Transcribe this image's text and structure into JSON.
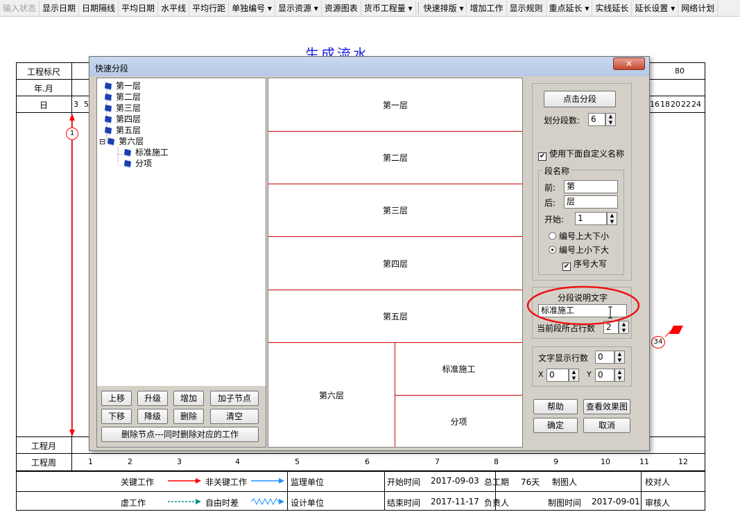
{
  "toolbar": {
    "items": [
      "输入状态",
      "显示日期",
      "日期隔线",
      "平均日期",
      "水平线",
      "平均行距",
      "单独编号 ▾",
      "显示资源 ▾",
      "资源图表",
      "货币工程量 ▾",
      "快速排版 ▾",
      "增加工作",
      "显示规则",
      "重点延长 ▾",
      "实线延长",
      "延长设置 ▾",
      "网络计划"
    ]
  },
  "background": {
    "title": "生成流水",
    "row_labels": {
      "ruler": "工程标尺",
      "year_month": "年.月",
      "day": "日",
      "project_month": "工程月",
      "project_week": "工程周"
    },
    "ruler_value": "80",
    "day_numbers_left": [
      "3",
      "5"
    ],
    "day_numbers_right": [
      "16",
      "18",
      "20",
      "22",
      "24"
    ],
    "node_1": "1",
    "node_34": "34",
    "week_numbers": [
      "1",
      "2",
      "3",
      "4",
      "5",
      "6",
      "7",
      "8",
      "9",
      "10",
      "11",
      "12"
    ],
    "colors": {
      "critical": "#ff0000",
      "noncritical": "#1e90ff",
      "virtual": "#009090",
      "title": "#2020e0"
    }
  },
  "footer": {
    "legend_critical": "关键工作",
    "legend_noncritical": "非关键工作",
    "legend_virtual": "虚工作",
    "legend_float": "自由时差",
    "supervisor_label": "监理单位",
    "design_label": "设计单位",
    "start_label": "开始时间",
    "start_value": "2017-09-03",
    "end_label": "结束时间",
    "end_value": "2017-11-17",
    "duration_label": "总工期",
    "duration_value": "76天",
    "owner_label": "负责人",
    "drafter_label": "制图人",
    "draw_time_label": "制图时间",
    "draw_time_value": "2017-09-01",
    "checker_label": "校对人",
    "reviewer_label": "审核人"
  },
  "dialog": {
    "title": "快速分段",
    "close": "✕",
    "tree": [
      {
        "label": "第一层",
        "level": 0
      },
      {
        "label": "第二层",
        "level": 0
      },
      {
        "label": "第三层",
        "level": 0
      },
      {
        "label": "第四层",
        "level": 0
      },
      {
        "label": "第五层",
        "level": 0
      },
      {
        "label": "第六层",
        "level": 0,
        "expander": "⊟"
      },
      {
        "label": "标准施工",
        "level": 1
      },
      {
        "label": "分项",
        "level": 1
      }
    ],
    "buttons": {
      "move_up": "上移",
      "promote": "升级",
      "add": "增加",
      "add_child": "加子节点",
      "move_down": "下移",
      "demote": "降级",
      "delete": "删除",
      "clear": "清空",
      "delete_node": "删除节点---同时删除对应的工作"
    },
    "segments": [
      "第一层",
      "第二层",
      "第三层",
      "第四层",
      "第五层",
      "第六层",
      "标准施工",
      "分项"
    ],
    "right": {
      "split_button": "点击分段",
      "count_label": "划分段数:",
      "count_value": "6",
      "use_custom_label": "使用下面自定义名称",
      "use_custom_checked": true,
      "seg_name_group": "段名称",
      "prefix_label": "前:",
      "prefix_value": "第",
      "suffix_label": "后:",
      "suffix_value": "层",
      "start_label": "开始:",
      "start_value": "1",
      "radio_1": "编号上大下小",
      "radio_2": "编号上小下大",
      "radio_selected": 2,
      "uppercase_label": "序号大写",
      "uppercase_checked": true,
      "desc_group": "分段说明文字",
      "desc_value": "标准施工",
      "rows_label": "当前段所占行数",
      "rows_value": "2",
      "text_rows_label": "文字显示行数",
      "text_rows_value": "0",
      "x_label": "X",
      "x_value": "0",
      "y_label": "Y",
      "y_value": "0",
      "help": "帮助",
      "preview": "查看效果图",
      "ok": "确定",
      "cancel": "取消"
    }
  }
}
